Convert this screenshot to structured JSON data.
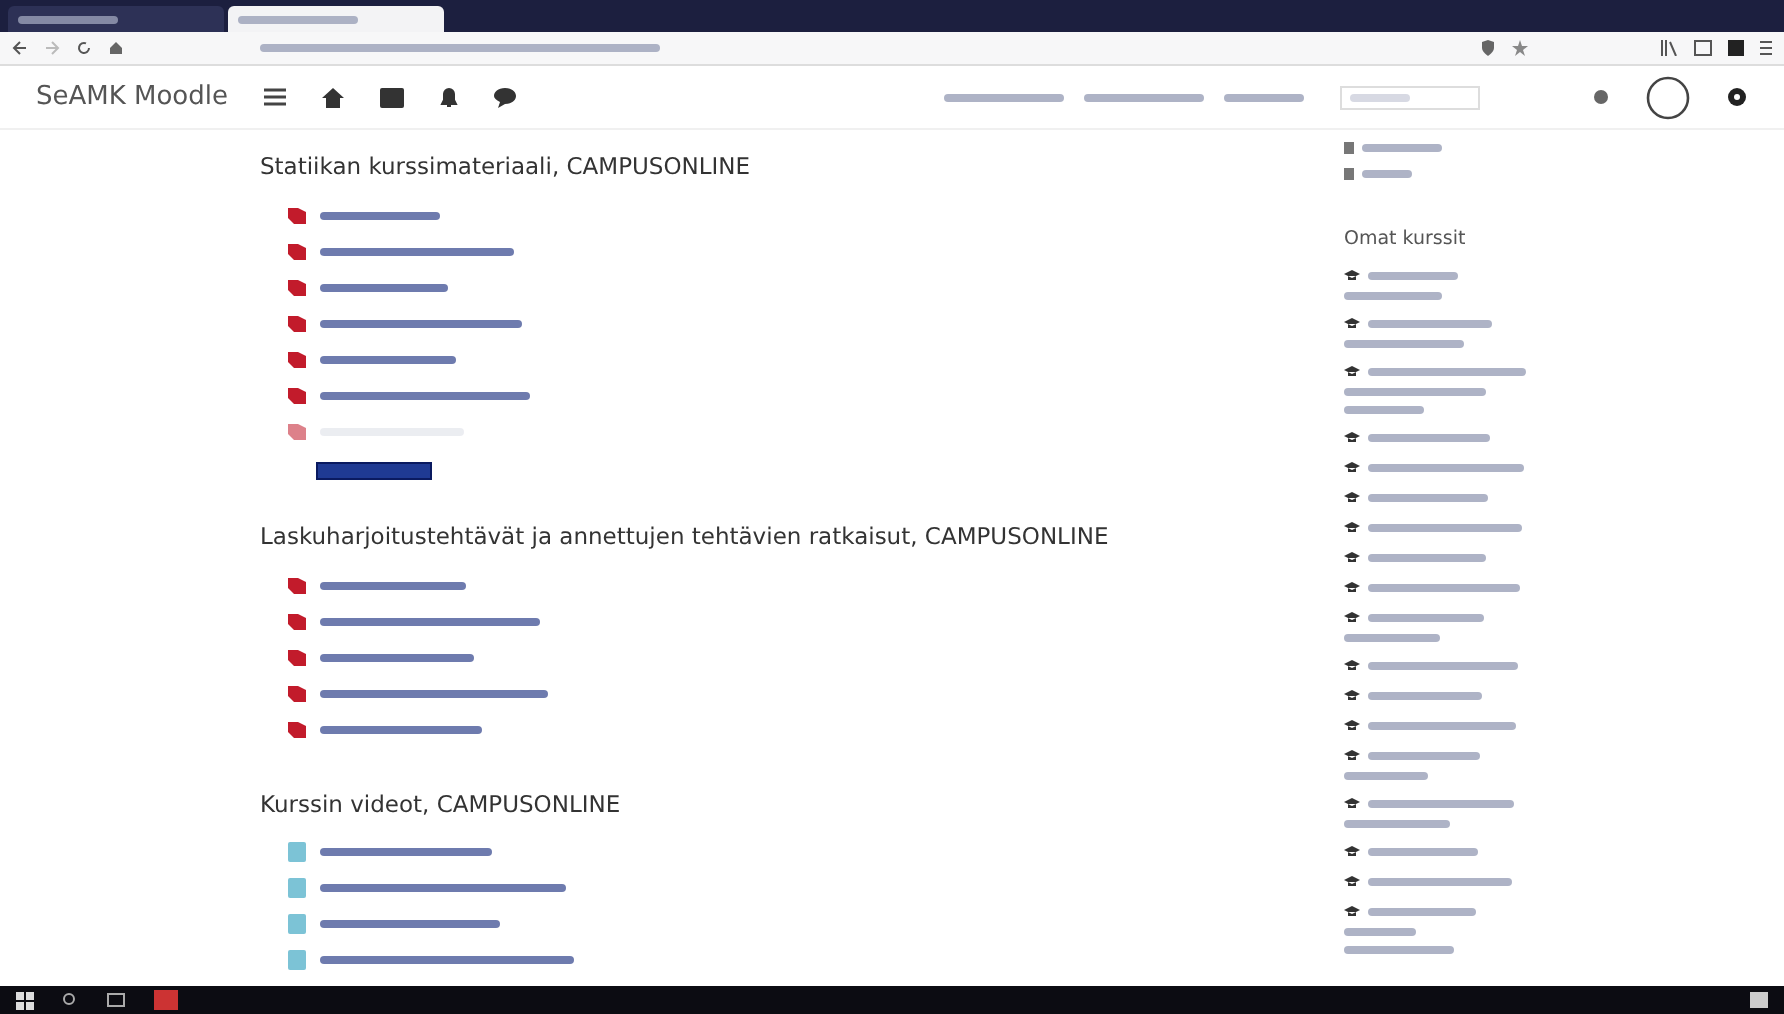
{
  "browser": {
    "tabs": [
      {
        "selected": false
      },
      {
        "selected": true
      }
    ]
  },
  "navbar": {
    "brand": "SeAMK Moodle"
  },
  "sections": [
    {
      "title": "Statiikan kurssimateriaali, CAMPUSONLINE",
      "edit_button": true,
      "items": [
        {
          "kind": "pdf",
          "dimmed": false
        },
        {
          "kind": "pdf",
          "dimmed": false
        },
        {
          "kind": "pdf",
          "dimmed": false
        },
        {
          "kind": "pdf",
          "dimmed": false
        },
        {
          "kind": "pdf",
          "dimmed": false
        },
        {
          "kind": "pdf",
          "dimmed": false
        },
        {
          "kind": "pdf",
          "dimmed": true
        }
      ]
    },
    {
      "title": "Laskuharjoitustehtävät ja annettujen tehtävien ratkaisut, CAMPUSONLINE",
      "edit_button": false,
      "items": [
        {
          "kind": "pdf",
          "dimmed": false
        },
        {
          "kind": "pdf",
          "dimmed": false
        },
        {
          "kind": "pdf",
          "dimmed": false
        },
        {
          "kind": "pdf",
          "dimmed": false
        },
        {
          "kind": "pdf",
          "dimmed": false
        }
      ]
    },
    {
      "title": "Kurssin videot, CAMPUSONLINE",
      "edit_button": false,
      "items": [
        {
          "kind": "video",
          "dimmed": false
        },
        {
          "kind": "video",
          "dimmed": false
        },
        {
          "kind": "video",
          "dimmed": false
        },
        {
          "kind": "video",
          "dimmed": false
        }
      ]
    }
  ],
  "sidebar": {
    "top_items": [
      {
        "kind": "link"
      },
      {
        "kind": "link"
      }
    ],
    "heading": "Omat kurssit",
    "courses": [
      {
        "kind": "two-line"
      },
      {
        "kind": "two-line"
      },
      {
        "kind": "three-line"
      },
      {
        "kind": "one-line"
      },
      {
        "kind": "one-line"
      },
      {
        "kind": "one-line"
      },
      {
        "kind": "one-line"
      },
      {
        "kind": "one-line"
      },
      {
        "kind": "one-line"
      },
      {
        "kind": "two-line"
      },
      {
        "kind": "one-line"
      },
      {
        "kind": "one-line"
      },
      {
        "kind": "one-line"
      },
      {
        "kind": "two-line"
      },
      {
        "kind": "two-line"
      },
      {
        "kind": "one-line"
      },
      {
        "kind": "one-line"
      },
      {
        "kind": "three-line"
      }
    ]
  }
}
